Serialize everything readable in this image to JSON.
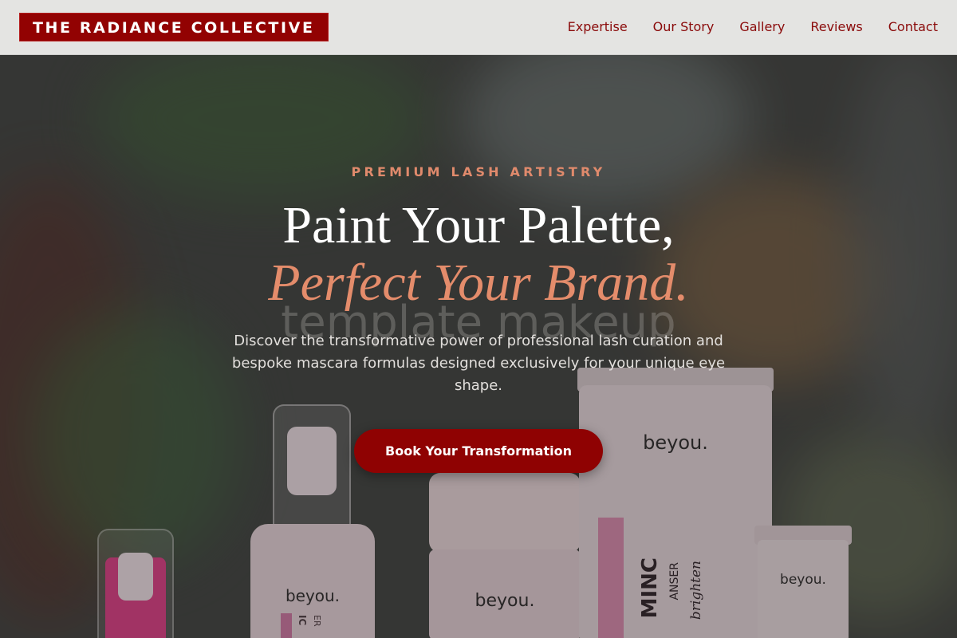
{
  "header": {
    "logo": "THE RADIANCE COLLECTIVE",
    "nav": [
      {
        "label": "Expertise"
      },
      {
        "label": "Our Story"
      },
      {
        "label": "Gallery"
      },
      {
        "label": "Reviews"
      },
      {
        "label": "Contact"
      }
    ]
  },
  "hero": {
    "eyebrow": "PREMIUM LASH ARTISTRY",
    "headline_line1": "Paint Your Palette,",
    "headline_line2": "Perfect Your Brand.",
    "watermark": "template makeup",
    "description": "Discover the transformative power of professional lash curation and bespoke mascara formulas designed exclusively for your unique eye shape.",
    "cta_label": "Book Your Transformation"
  },
  "products": {
    "brand": "beyou.",
    "tube_line1": "MINC",
    "tube_line2": "ANSER",
    "tube_line3": "brighten",
    "small_bottle_line1": "IC",
    "small_bottle_line2": "ER"
  },
  "colors": {
    "brand_red": "#920202",
    "accent_salmon": "#e48c6b",
    "header_bg": "#e4e4e2",
    "product_pink": "#e9d2da",
    "product_magenta": "#e63a8a"
  }
}
